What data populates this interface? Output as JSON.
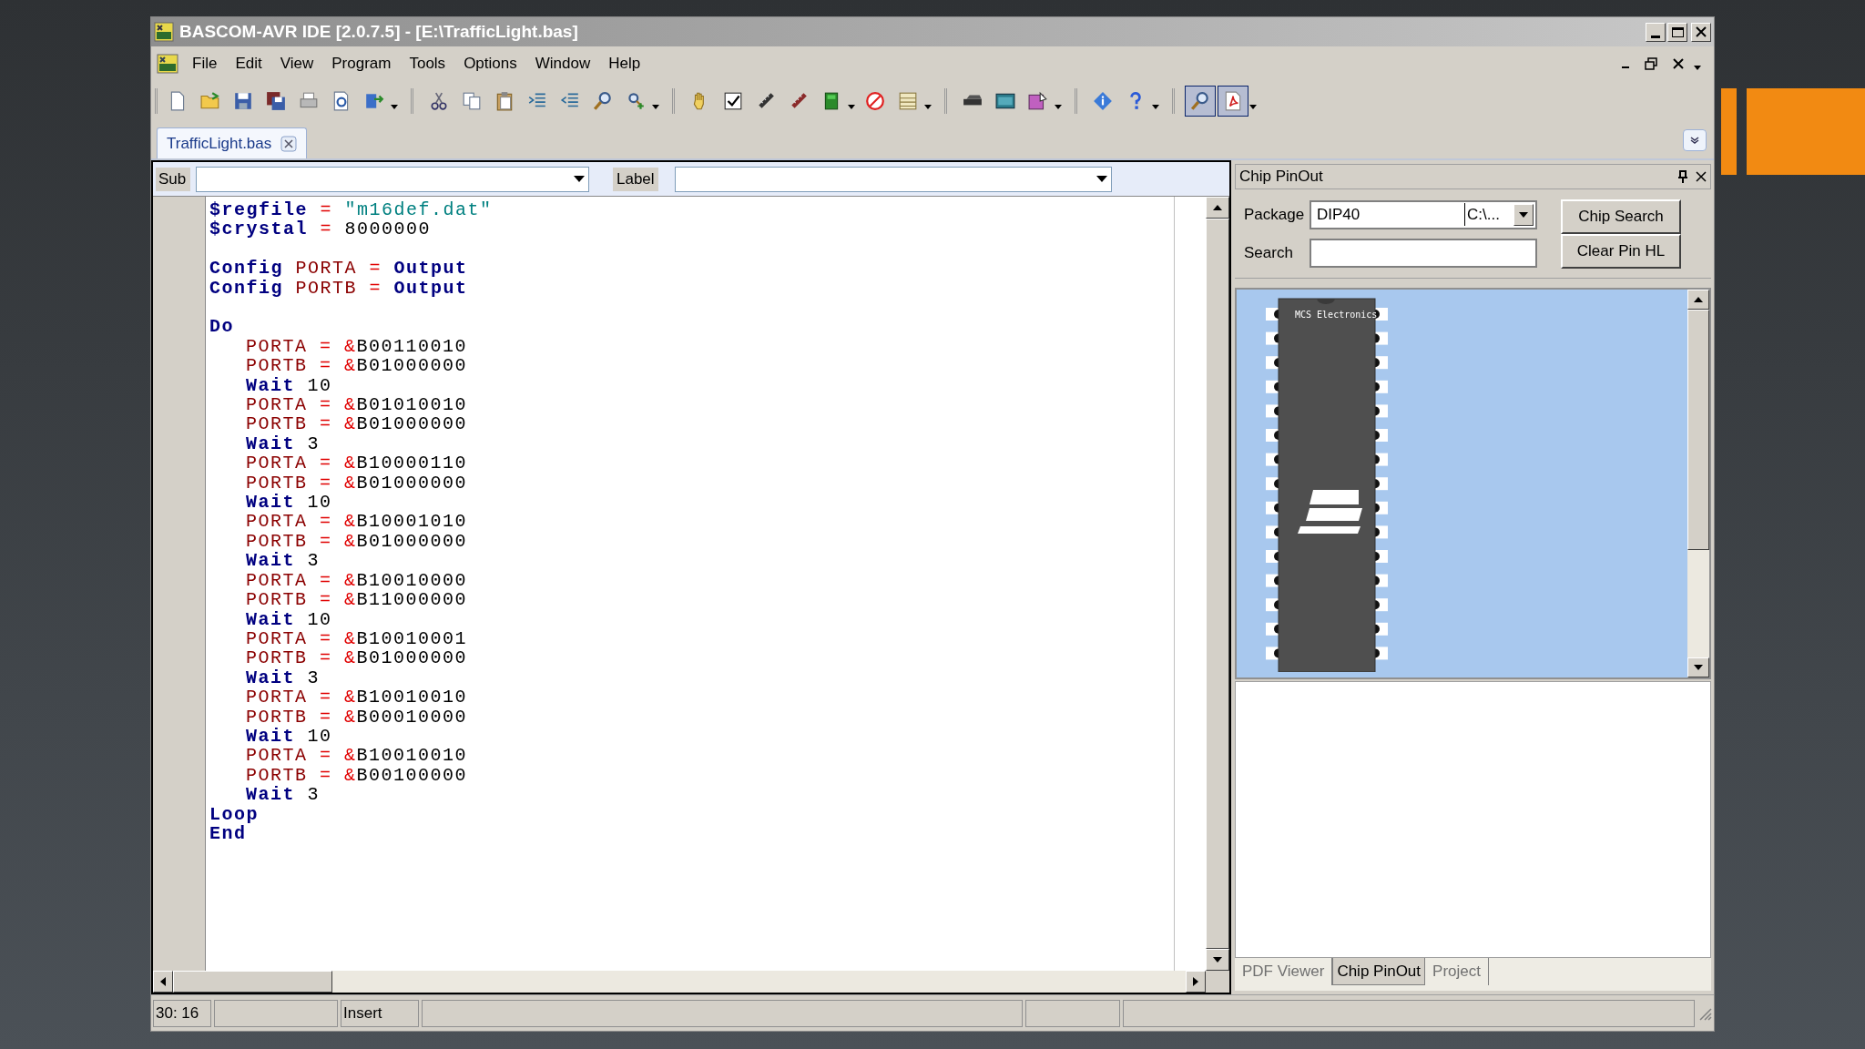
{
  "window": {
    "title": "BASCOM-AVR IDE [2.0.7.5] - [E:\\TrafficLight.bas]"
  },
  "menu": [
    "File",
    "Edit",
    "View",
    "Program",
    "Tools",
    "Options",
    "Window",
    "Help"
  ],
  "toolbar_toggles": [
    {
      "pressed": true
    },
    {
      "pressed": true
    }
  ],
  "document_tabs": [
    {
      "label": "TrafficLight.bas",
      "selected": true
    }
  ],
  "navigation_bar": {
    "sub_label": "Sub",
    "label_label": "Label"
  },
  "code_lines": [
    {
      "indented": false,
      "gap_before": false,
      "tokens": [
        {
          "kind": "directive",
          "text": "$regfile"
        },
        {
          "kind": "operator",
          "text": "="
        },
        {
          "kind": "string",
          "text": "\"m16def.dat\""
        }
      ]
    },
    {
      "indented": false,
      "gap_before": false,
      "tokens": [
        {
          "kind": "directive",
          "text": "$crystal"
        },
        {
          "kind": "operator",
          "text": "="
        },
        {
          "kind": "number",
          "text": "8000000"
        }
      ]
    },
    {
      "indented": false,
      "gap_before": true,
      "tokens": [
        {
          "kind": "keyword",
          "text": "Config"
        },
        {
          "kind": "port",
          "text": "PORTA"
        },
        {
          "kind": "operator",
          "text": "="
        },
        {
          "kind": "keyword",
          "text": "Output"
        }
      ]
    },
    {
      "indented": false,
      "gap_before": false,
      "tokens": [
        {
          "kind": "keyword",
          "text": "Config"
        },
        {
          "kind": "port",
          "text": "PORTB"
        },
        {
          "kind": "operator",
          "text": "="
        },
        {
          "kind": "keyword",
          "text": "Output"
        }
      ]
    },
    {
      "indented": false,
      "gap_before": true,
      "tokens": [
        {
          "kind": "keyword",
          "text": "Do"
        }
      ]
    },
    {
      "indented": true,
      "gap_before": false,
      "tokens": [
        {
          "kind": "port",
          "text": "PORTA"
        },
        {
          "kind": "operator",
          "text": "="
        },
        {
          "kind": "binary",
          "text": "&B00110010"
        }
      ]
    },
    {
      "indented": true,
      "gap_before": false,
      "tokens": [
        {
          "kind": "port",
          "text": "PORTB"
        },
        {
          "kind": "operator",
          "text": "="
        },
        {
          "kind": "binary",
          "text": "&B01000000"
        }
      ]
    },
    {
      "indented": true,
      "gap_before": false,
      "tokens": [
        {
          "kind": "keyword",
          "text": "Wait"
        },
        {
          "kind": "number",
          "text": "10"
        }
      ]
    },
    {
      "indented": true,
      "gap_before": false,
      "tokens": [
        {
          "kind": "port",
          "text": "PORTA"
        },
        {
          "kind": "operator",
          "text": "="
        },
        {
          "kind": "binary",
          "text": "&B01010010"
        }
      ]
    },
    {
      "indented": true,
      "gap_before": false,
      "tokens": [
        {
          "kind": "port",
          "text": "PORTB"
        },
        {
          "kind": "operator",
          "text": "="
        },
        {
          "kind": "binary",
          "text": "&B01000000"
        }
      ]
    },
    {
      "indented": true,
      "gap_before": false,
      "tokens": [
        {
          "kind": "keyword",
          "text": "Wait"
        },
        {
          "kind": "number",
          "text": "3"
        }
      ]
    },
    {
      "indented": true,
      "gap_before": false,
      "tokens": [
        {
          "kind": "port",
          "text": "PORTA"
        },
        {
          "kind": "operator",
          "text": "="
        },
        {
          "kind": "binary",
          "text": "&B10000110"
        }
      ]
    },
    {
      "indented": true,
      "gap_before": false,
      "tokens": [
        {
          "kind": "port",
          "text": "PORTB"
        },
        {
          "kind": "operator",
          "text": "="
        },
        {
          "kind": "binary",
          "text": "&B01000000"
        }
      ]
    },
    {
      "indented": true,
      "gap_before": false,
      "tokens": [
        {
          "kind": "keyword",
          "text": "Wait"
        },
        {
          "kind": "number",
          "text": "10"
        }
      ]
    },
    {
      "indented": true,
      "gap_before": false,
      "tokens": [
        {
          "kind": "port",
          "text": "PORTA"
        },
        {
          "kind": "operator",
          "text": "="
        },
        {
          "kind": "binary",
          "text": "&B10001010"
        }
      ]
    },
    {
      "indented": true,
      "gap_before": false,
      "tokens": [
        {
          "kind": "port",
          "text": "PORTB"
        },
        {
          "kind": "operator",
          "text": "="
        },
        {
          "kind": "binary",
          "text": "&B01000000"
        }
      ]
    },
    {
      "indented": true,
      "gap_before": false,
      "tokens": [
        {
          "kind": "keyword",
          "text": "Wait"
        },
        {
          "kind": "number",
          "text": "3"
        }
      ]
    },
    {
      "indented": true,
      "gap_before": false,
      "tokens": [
        {
          "kind": "port",
          "text": "PORTA"
        },
        {
          "kind": "operator",
          "text": "="
        },
        {
          "kind": "binary",
          "text": "&B10010000"
        }
      ]
    },
    {
      "indented": true,
      "gap_before": false,
      "tokens": [
        {
          "kind": "port",
          "text": "PORTB"
        },
        {
          "kind": "operator",
          "text": "="
        },
        {
          "kind": "binary",
          "text": "&B11000000"
        }
      ]
    },
    {
      "indented": true,
      "gap_before": false,
      "tokens": [
        {
          "kind": "keyword",
          "text": "Wait"
        },
        {
          "kind": "number",
          "text": "10"
        }
      ]
    },
    {
      "indented": true,
      "gap_before": false,
      "tokens": [
        {
          "kind": "port",
          "text": "PORTA"
        },
        {
          "kind": "operator",
          "text": "="
        },
        {
          "kind": "binary",
          "text": "&B10010001"
        }
      ]
    },
    {
      "indented": true,
      "gap_before": false,
      "tokens": [
        {
          "kind": "port",
          "text": "PORTB"
        },
        {
          "kind": "operator",
          "text": "="
        },
        {
          "kind": "binary",
          "text": "&B01000000"
        }
      ]
    },
    {
      "indented": true,
      "gap_before": false,
      "tokens": [
        {
          "kind": "keyword",
          "text": "Wait"
        },
        {
          "kind": "number",
          "text": "3"
        }
      ]
    },
    {
      "indented": true,
      "gap_before": false,
      "tokens": [
        {
          "kind": "port",
          "text": "PORTA"
        },
        {
          "kind": "operator",
          "text": "="
        },
        {
          "kind": "binary",
          "text": "&B10010010"
        }
      ]
    },
    {
      "indented": true,
      "gap_before": false,
      "tokens": [
        {
          "kind": "port",
          "text": "PORTB"
        },
        {
          "kind": "operator",
          "text": "="
        },
        {
          "kind": "binary",
          "text": "&B00010000"
        }
      ]
    },
    {
      "indented": true,
      "gap_before": false,
      "tokens": [
        {
          "kind": "keyword",
          "text": "Wait"
        },
        {
          "kind": "number",
          "text": "10"
        }
      ]
    },
    {
      "indented": true,
      "gap_before": false,
      "tokens": [
        {
          "kind": "port",
          "text": "PORTA"
        },
        {
          "kind": "operator",
          "text": "="
        },
        {
          "kind": "binary",
          "text": "&B10010010"
        }
      ]
    },
    {
      "indented": true,
      "gap_before": false,
      "tokens": [
        {
          "kind": "port",
          "text": "PORTB"
        },
        {
          "kind": "operator",
          "text": "="
        },
        {
          "kind": "binary",
          "text": "&B00100000"
        }
      ]
    },
    {
      "indented": true,
      "gap_before": false,
      "tokens": [
        {
          "kind": "keyword",
          "text": "Wait"
        },
        {
          "kind": "number",
          "text": "3"
        }
      ]
    },
    {
      "indented": false,
      "gap_before": false,
      "tokens": [
        {
          "kind": "keyword",
          "text": "Loop"
        }
      ]
    },
    {
      "indented": false,
      "gap_before": false,
      "tokens": [
        {
          "kind": "keyword",
          "text": "End"
        }
      ]
    }
  ],
  "chip_pinout": {
    "title": "Chip PinOut",
    "package_label": "Package",
    "package_value": "DIP40",
    "package_path": "C:\\...",
    "search_label": "Search",
    "buttons": [
      "Chip Search",
      "Clear Pin HL"
    ],
    "chip_label": "MCS Electronics"
  },
  "bottom_tabs": [
    {
      "label": "PDF Viewer",
      "selected": false
    },
    {
      "label": "Chip PinOut",
      "selected": true
    },
    {
      "label": "Project",
      "selected": false
    }
  ],
  "status_bar": {
    "position": "30: 16",
    "mode": "Insert"
  }
}
